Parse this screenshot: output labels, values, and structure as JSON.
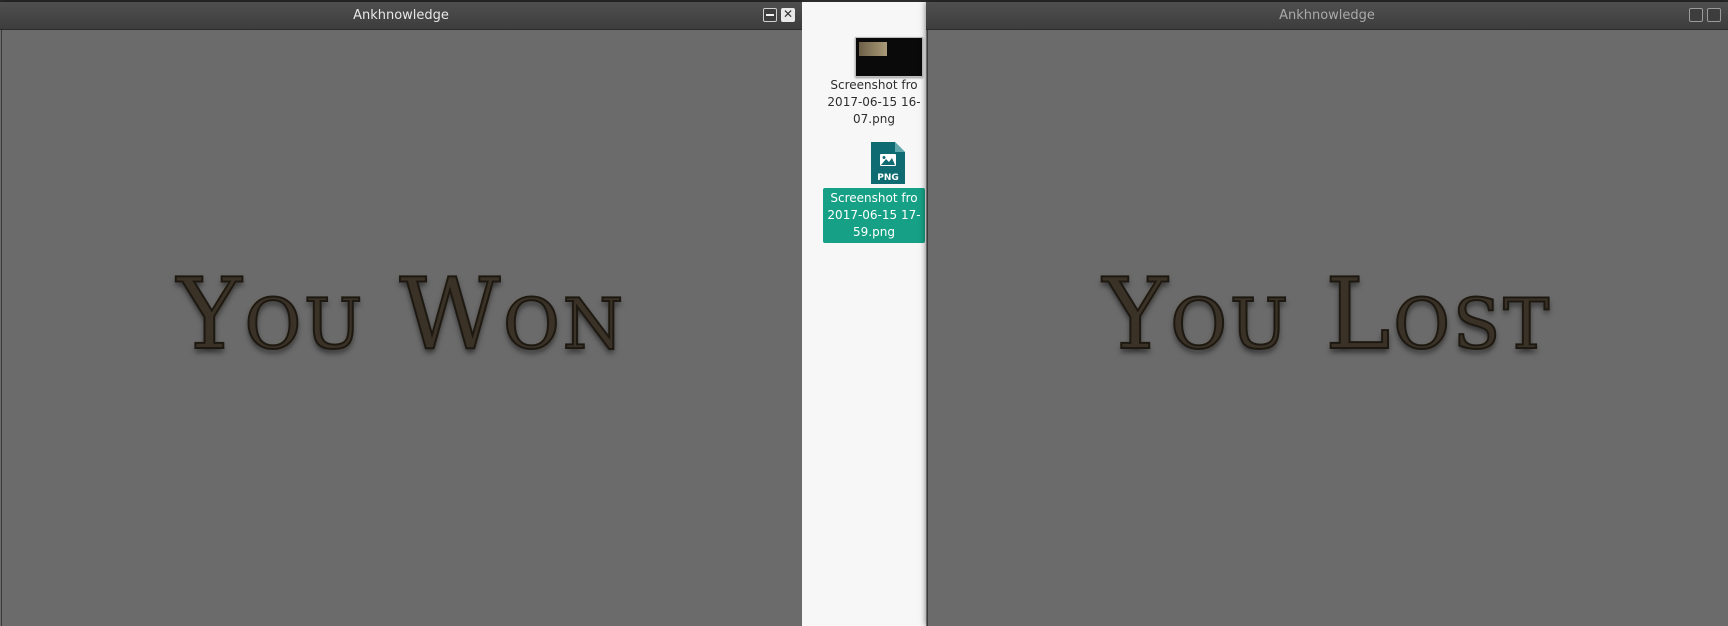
{
  "left_window": {
    "title": "Ankhnowledge",
    "message": "You Won",
    "buttons": [
      "minimize",
      "close"
    ]
  },
  "right_window": {
    "title": "Ankhnowledge",
    "message": "You Lost",
    "buttons": [
      "maximize",
      "restore"
    ]
  },
  "desktop_icons": [
    {
      "label_lines": [
        "Screenshot fro",
        "2017-06-15 16-",
        "07.png"
      ],
      "icon": "image-thumbnail-icon",
      "selected": false
    },
    {
      "label_lines": [
        "Screenshot fro",
        "2017-06-15 17-",
        "59.png"
      ],
      "icon": "png-file-icon",
      "file_badge": "PNG",
      "selected": true
    }
  ],
  "colors": {
    "window_background": "#6b6b6b",
    "titlebar": "#444444",
    "selection": "#16a085",
    "png_icon": "#0e6b72",
    "message_text": "#3a3226"
  }
}
